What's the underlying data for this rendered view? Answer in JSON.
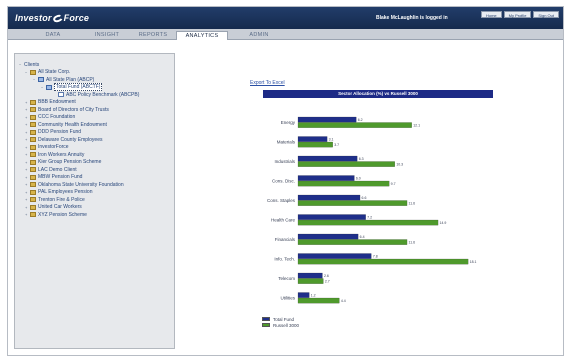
{
  "header": {
    "logo_text_1": "Investor",
    "logo_text_2": "Force",
    "user_text": "Blake McLaughlin is logged in",
    "buttons": [
      "Home",
      "My Profile",
      "Sign Out"
    ]
  },
  "nav": {
    "tabs": [
      "DATA",
      "INSIGHT",
      "REPORTS",
      "ANALYTICS",
      "ADMIN"
    ],
    "active": "ANALYTICS"
  },
  "tree": [
    {
      "label": "Clients",
      "level": 0,
      "icon": "none",
      "expander": "−"
    },
    {
      "label": "All State Corp.",
      "level": 1,
      "icon": "folder",
      "expander": "−"
    },
    {
      "label": "All State Plan (ABCP)",
      "level": 2,
      "icon": "plan",
      "expander": "−"
    },
    {
      "label": "Total Fund (ABCTF)",
      "level": 3,
      "icon": "plan",
      "expander": "−",
      "selected": true
    },
    {
      "label": "ABC Policy Benchmark (ABCPB)",
      "level": 4,
      "icon": "doc",
      "expander": ""
    },
    {
      "label": "BBB Endowment",
      "level": 1,
      "icon": "folder",
      "expander": "+"
    },
    {
      "label": "Board of Directors of City Trusts",
      "level": 1,
      "icon": "folder",
      "expander": "+"
    },
    {
      "label": "CCC Foundation",
      "level": 1,
      "icon": "folder",
      "expander": "+"
    },
    {
      "label": "Community Health Endowment",
      "level": 1,
      "icon": "folder",
      "expander": "+"
    },
    {
      "label": "DDD Pension Fund",
      "level": 1,
      "icon": "folder",
      "expander": "+"
    },
    {
      "label": "Delaware County Employees",
      "level": 1,
      "icon": "folder",
      "expander": "+"
    },
    {
      "label": "InvestorForce",
      "level": 1,
      "icon": "folder",
      "expander": "+"
    },
    {
      "label": "Iron Workers Annuity",
      "level": 1,
      "icon": "folder",
      "expander": "+"
    },
    {
      "label": "Kier Group Pension Scheme",
      "level": 1,
      "icon": "folder",
      "expander": "+"
    },
    {
      "label": "LAC Demo Client",
      "level": 1,
      "icon": "folder",
      "expander": "+"
    },
    {
      "label": "MBW Pension Fund",
      "level": 1,
      "icon": "folder",
      "expander": "+"
    },
    {
      "label": "Oklahoma State University Foundation",
      "level": 1,
      "icon": "folder",
      "expander": "+"
    },
    {
      "label": "PAL Employees Pension",
      "level": 1,
      "icon": "folder",
      "expander": "+"
    },
    {
      "label": "Trenton Fire & Police",
      "level": 1,
      "icon": "folder",
      "expander": "+"
    },
    {
      "label": "United Car Workers",
      "level": 1,
      "icon": "folder",
      "expander": "+"
    },
    {
      "label": "XYZ Pension Scheme",
      "level": 1,
      "icon": "folder",
      "expander": "+"
    }
  ],
  "main": {
    "export_link": "Export To Excel"
  },
  "chart_data": {
    "type": "bar",
    "orientation": "horizontal",
    "title": "Sector Allocation (%) vs Russell 3000",
    "categories": [
      "Energy",
      "Materials",
      "Industrials",
      "Cons. Disc.",
      "Cons. Staples",
      "Health Care",
      "Financials",
      "Info. Tech.",
      "Telecom",
      "Utilities"
    ],
    "series": [
      {
        "name": "Total Fund",
        "color": "#1f2f8a",
        "values": [
          6.2,
          3.1,
          6.3,
          6.0,
          6.6,
          7.2,
          6.4,
          7.8,
          2.6,
          1.2
        ]
      },
      {
        "name": "Russell 3000",
        "color": "#4f9a2c",
        "values": [
          12.1,
          3.7,
          10.3,
          9.7,
          11.6,
          14.9,
          11.6,
          18.1,
          2.7,
          4.4
        ]
      }
    ],
    "xlim": [
      0,
      20
    ],
    "xticks": [
      "0.0",
      "5.0",
      "10.0",
      "15.0",
      "20.0"
    ],
    "legend_position": "bottom-left",
    "grid": false
  }
}
